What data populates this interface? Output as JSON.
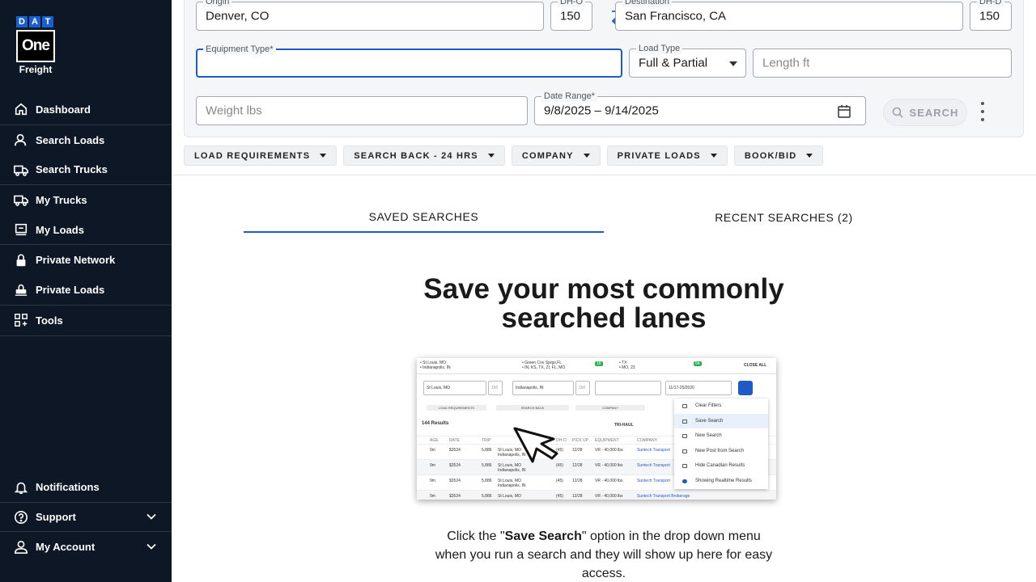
{
  "sidebar": {
    "logo": {
      "letters": [
        "D",
        "A",
        "T"
      ],
      "one": "One",
      "freight": "Freight"
    },
    "items": [
      {
        "label": "Dashboard",
        "icon": "home-icon"
      },
      {
        "label": "Search Loads",
        "icon": "search-person-icon"
      },
      {
        "label": "Search Trucks",
        "icon": "truck-icon"
      },
      {
        "label": "My Trucks",
        "icon": "truck-clock-icon"
      },
      {
        "label": "My Loads",
        "icon": "loads-icon"
      },
      {
        "label": "Private Network",
        "icon": "lock-icon"
      },
      {
        "label": "Private Loads",
        "icon": "private-loads-icon"
      },
      {
        "label": "Tools",
        "icon": "tools-grid-icon"
      }
    ],
    "bottom": [
      {
        "label": "Notifications",
        "icon": "bell-icon"
      },
      {
        "label": "Support",
        "icon": "help-icon"
      },
      {
        "label": "My Account",
        "icon": "user-icon"
      }
    ]
  },
  "form": {
    "origin": {
      "label": "Origin",
      "value": "Denver, CO"
    },
    "dh_o": {
      "label": "DH-O",
      "value": "150"
    },
    "destination": {
      "label": "Destination",
      "value": "San Francisco, CA"
    },
    "dh_d": {
      "label": "DH-D",
      "value": "150"
    },
    "equipment": {
      "label": "Equipment Type*",
      "value": ""
    },
    "load_type": {
      "label": "Load Type",
      "value": "Full & Partial"
    },
    "length": {
      "placeholder": "Length ft"
    },
    "weight": {
      "placeholder": "Weight lbs"
    },
    "date_range": {
      "label": "Date Range*",
      "value": "9/8/2025 – 9/14/2025"
    },
    "search_label": "SEARCH"
  },
  "filters": [
    "LOAD REQUIREMENTS",
    "SEARCH BACK - 24 HRS",
    "COMPANY",
    "PRIVATE LOADS",
    "BOOK/BID"
  ],
  "tabs": {
    "saved": "SAVED SEARCHES",
    "recent": "RECENT SEARCHES (2)"
  },
  "empty_state": {
    "title": "Save your most commonly searched lanes",
    "desc_pre": "Click the \"",
    "desc_bold": "Save Search",
    "desc_post": "\" option in the drop down menu when you run a search and they will show up here for easy access."
  },
  "preview": {
    "tab1": "• St Louis, MO",
    "tab1b": "• Indianapolis, IN",
    "tab2": "• Green Cov Sprgs,FL",
    "tab2b": "• IN, KS, TX, ZI, FL, MO",
    "tab3": "• TX",
    "tab3b": "• MO, 23",
    "badge1": "18",
    "badge2": "54",
    "close_all": "CLOSE ALL",
    "origin": "St Louis, MO",
    "destination": "Indianapolis, IN",
    "dh": "150",
    "date": "11/17-25/2020",
    "results": "144 Results",
    "trihaul": "TRI-HAUL",
    "menu": [
      "Clear Filters",
      "Save Search",
      "New Search",
      "New Post from Search",
      "Hide Canadian Results",
      "Showing Realtime Results"
    ],
    "chips": [
      "LOAD REQUIREMENTS",
      "SEARCH BACK",
      "COMPANY"
    ],
    "headers": [
      "AGE",
      "RATE",
      "TRIP",
      "DH-O",
      "PICK UP",
      "EQUIPMENT",
      "COMPANY"
    ],
    "rows": [
      {
        "age": "9m",
        "rate": "$3524",
        "trip": "5,886",
        "origin": "St Louis, MO",
        "dest": "Indianapolis, IN",
        "dh": "(45)",
        "pickup": "12/28",
        "equip": "VR - 40,000 lbs",
        "company": "Suntech Transport"
      },
      {
        "age": "9m",
        "rate": "$3524",
        "trip": "5,886",
        "origin": "St Louis, MO",
        "dest": "Indianapolis, IN",
        "dh": "(45)",
        "pickup": "12/28",
        "equip": "VR - 40,000 lbs",
        "company": "Suntech Transport"
      },
      {
        "age": "9m",
        "rate": "$3524",
        "trip": "5,886",
        "origin": "St Louis, MO",
        "dest": "Indianapolis, IN",
        "dh": "(45)",
        "pickup": "12/28",
        "equip": "VR - 40,000 lbs",
        "company": "Suntech Transport"
      },
      {
        "age": "9m",
        "rate": "$3524",
        "trip": "5,886",
        "origin": "St Louis, MO",
        "dest": "Indianapolis, IN",
        "dh": "(45)",
        "pickup": "12/28",
        "equip": "VR - 40,000 lbs",
        "company": "Suntech Transport Brokerage"
      }
    ]
  }
}
